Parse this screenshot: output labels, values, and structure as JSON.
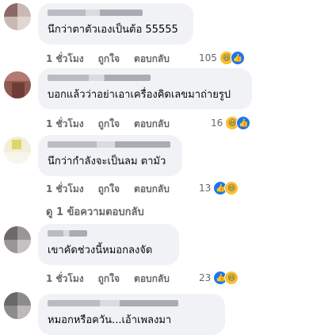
{
  "comments": [
    {
      "text": "นึกว่าตาตัวเองเป็นต้อ 55555",
      "time": "1 ชั่วโมง",
      "like": "ถูกใจ",
      "reply": "ตอบกลับ",
      "count": "105"
    },
    {
      "text": "บอกแล้วว่าอย่าเอาเครื่องคิดเลขมาถ่ายรูป",
      "time": "1 ชั่วโมง",
      "like": "ถูกใจ",
      "reply": "ตอบกลับ",
      "count": "16"
    },
    {
      "text": "นึกว่ากำลังจะเป็นลม ตามัว",
      "time": "1 ชั่วโมง",
      "like": "ถูกใจ",
      "reply": "ตอบกลับ",
      "count": "13"
    },
    {
      "text": "เขาคัดช่วงนี้หมอกลงจัด",
      "time": "1 ชั่วโมง",
      "like": "ถูกใจ",
      "reply": "ตอบกลับ",
      "count": "23"
    },
    {
      "text": "หมอกหรือควัน...เอ้าเพลงมา"
    }
  ],
  "view_replies": "ดู 1 ข้อความตอบกลับ",
  "icons": [
    "haha-icon",
    "like-icon"
  ],
  "colors": {
    "bubble": "#f0f2f5",
    "meta": "#65676b",
    "like": "#1877f2",
    "haha": "#f7c02c"
  }
}
